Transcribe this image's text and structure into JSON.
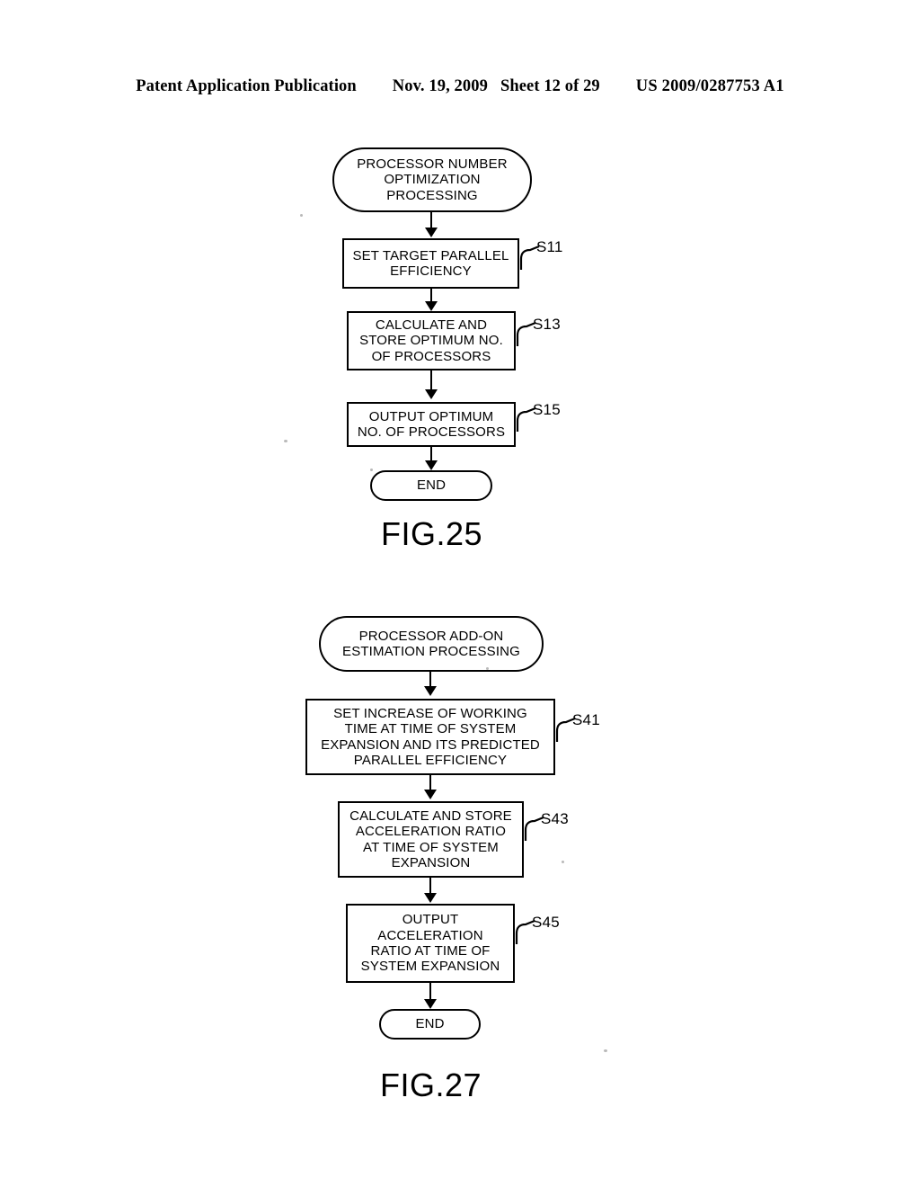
{
  "header": {
    "publication": "Patent Application Publication",
    "date": "Nov. 19, 2009",
    "sheet": "Sheet 12 of 29",
    "patent_number": "US 2009/0287753 A1"
  },
  "figures": [
    {
      "caption": "FIG.25",
      "nodes": [
        {
          "id": "start25",
          "kind": "terminal",
          "text": "PROCESSOR NUMBER\nOPTIMIZATION\nPROCESSING",
          "step": null
        },
        {
          "id": "s11",
          "kind": "process",
          "text": "SET TARGET PARALLEL\nEFFICIENCY",
          "step": "S11"
        },
        {
          "id": "s13",
          "kind": "process",
          "text": "CALCULATE AND\nSTORE OPTIMUM NO.\nOF PROCESSORS",
          "step": "S13"
        },
        {
          "id": "s15",
          "kind": "process",
          "text": "OUTPUT OPTIMUM\nNO. OF PROCESSORS",
          "step": "S15"
        },
        {
          "id": "end25",
          "kind": "terminal",
          "text": "END",
          "step": null
        }
      ]
    },
    {
      "caption": "FIG.27",
      "nodes": [
        {
          "id": "start27",
          "kind": "terminal",
          "text": "PROCESSOR ADD-ON\nESTIMATION PROCESSING",
          "step": null
        },
        {
          "id": "s41",
          "kind": "process",
          "text": "SET INCREASE OF WORKING\nTIME AT TIME OF SYSTEM\nEXPANSION AND ITS PREDICTED\nPARALLEL EFFICIENCY",
          "step": "S41"
        },
        {
          "id": "s43",
          "kind": "process",
          "text": "CALCULATE AND STORE\nACCELERATION RATIO\nAT TIME OF SYSTEM\nEXPANSION",
          "step": "S43"
        },
        {
          "id": "s45",
          "kind": "process",
          "text": "OUTPUT\nACCELERATION\nRATIO AT TIME OF\nSYSTEM EXPANSION",
          "step": "S45"
        },
        {
          "id": "end27",
          "kind": "terminal",
          "text": "END",
          "step": null
        }
      ]
    }
  ]
}
